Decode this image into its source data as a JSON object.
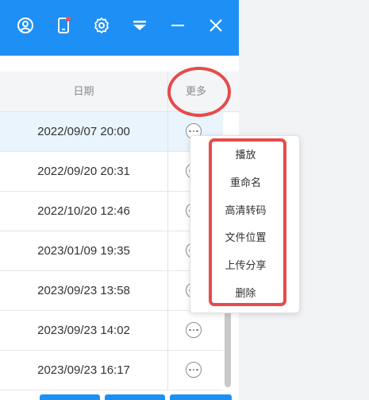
{
  "titlebar": {
    "color": "#1e90f5",
    "icons": [
      "user-icon",
      "phone-icon",
      "gear-icon",
      "dropdown-icon",
      "minimize-icon",
      "close-icon"
    ]
  },
  "table": {
    "headers": {
      "date": "日期",
      "more": "更多"
    },
    "rows": [
      {
        "date": "2022/09/07 20:00",
        "selected": true
      },
      {
        "date": "2022/09/20 20:31",
        "selected": false
      },
      {
        "date": "2022/10/20 12:46",
        "selected": false
      },
      {
        "date": "2023/01/09 19:35",
        "selected": false
      },
      {
        "date": "2023/09/23 13:58",
        "selected": false
      },
      {
        "date": "2023/09/23 14:02",
        "selected": false
      },
      {
        "date": "2023/09/23 16:17",
        "selected": false
      }
    ]
  },
  "context_menu": {
    "items": [
      "播放",
      "重命名",
      "高清转码",
      "文件位置",
      "上传分享",
      "删除"
    ]
  },
  "highlight_color": "#e64b4b"
}
